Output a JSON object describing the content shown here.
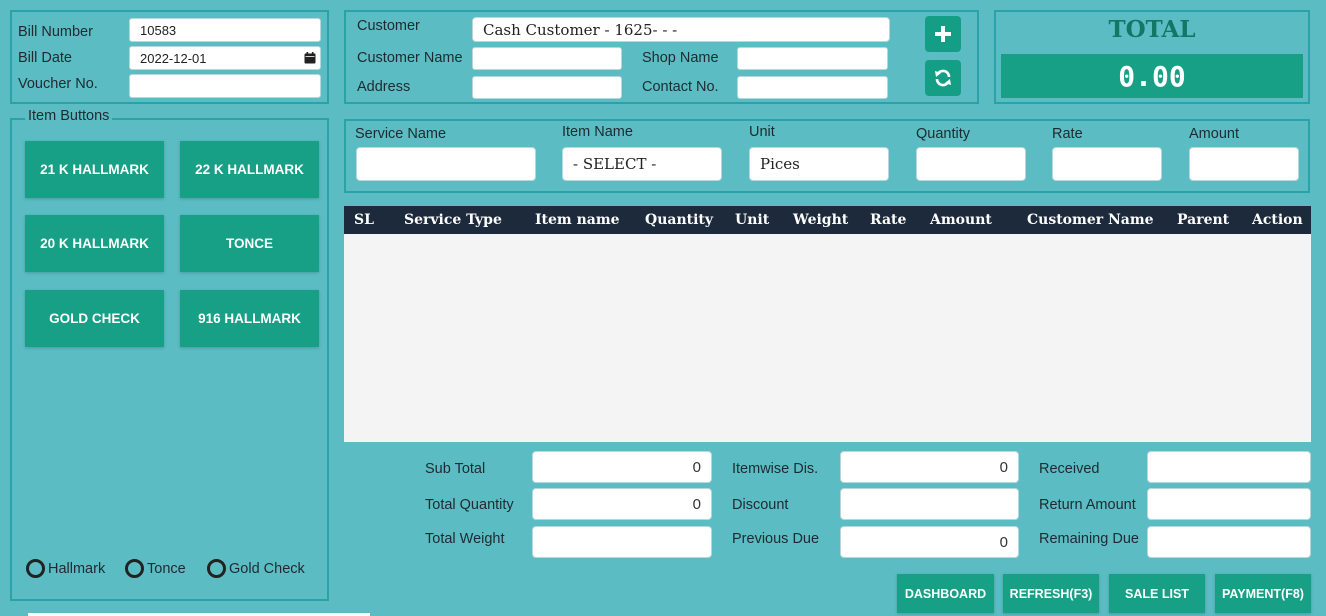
{
  "bill": {
    "bill_number_label": "Bill Number",
    "bill_number_value": "10583",
    "bill_date_label": "Bill Date",
    "bill_date_value": "2022-12-01",
    "voucher_label": "Voucher No.",
    "voucher_value": ""
  },
  "customer": {
    "customer_label": "Customer",
    "customer_value": "Cash Customer - 1625- - -",
    "customer_name_label": "Customer Name",
    "shop_name_label": "Shop Name",
    "address_label": "Address",
    "contact_label": "Contact No.",
    "add_icon": "plus-icon",
    "refresh_icon": "refresh-icon"
  },
  "total": {
    "title": "TOTAL",
    "value": "0.00"
  },
  "item_buttons": {
    "legend": "Item Buttons",
    "buttons": [
      "21 K HALLMARK",
      "22 K HALLMARK",
      "20 K HALLMARK",
      "TONCE",
      "GOLD CHECK",
      "916 HALLMARK"
    ]
  },
  "radios": [
    "Hallmark",
    "Tonce",
    "Gold Check"
  ],
  "entry": {
    "service_name_label": "Service Name",
    "item_name_label": "Item Name",
    "item_name_value": "- SELECT -",
    "unit_label": "Unit",
    "unit_value": "Pices",
    "quantity_label": "Quantity",
    "rate_label": "Rate",
    "amount_label": "Amount"
  },
  "table": {
    "columns": [
      "SL",
      "Service Type",
      "Item name",
      "Quantity",
      "Unit",
      "Weight",
      "Rate",
      "Amount",
      "Customer Name",
      "Parent",
      "Action"
    ]
  },
  "summary": {
    "sub_total_label": "Sub Total",
    "sub_total_value": "0",
    "total_quantity_label": "Total Quantity",
    "total_quantity_value": "0",
    "total_weight_label": "Total Weight",
    "itemwise_dis_label": "Itemwise Dis.",
    "itemwise_dis_value": "0",
    "discount_label": "Discount",
    "previous_due_label": "Previous Due",
    "previous_due_value": "0",
    "received_label": "Received",
    "return_amount_label": "Return Amount",
    "remaining_due_label": "Remaining Due"
  },
  "actions": {
    "dashboard": "DASHBOARD",
    "refresh": "REFRESH(F3)",
    "sale_list": "SALE LIST",
    "payment": "PAYMENT(F8)"
  },
  "colors": {
    "background": "#5bbcc3",
    "accent": "#17a085",
    "table_header": "#1c2a3c"
  }
}
